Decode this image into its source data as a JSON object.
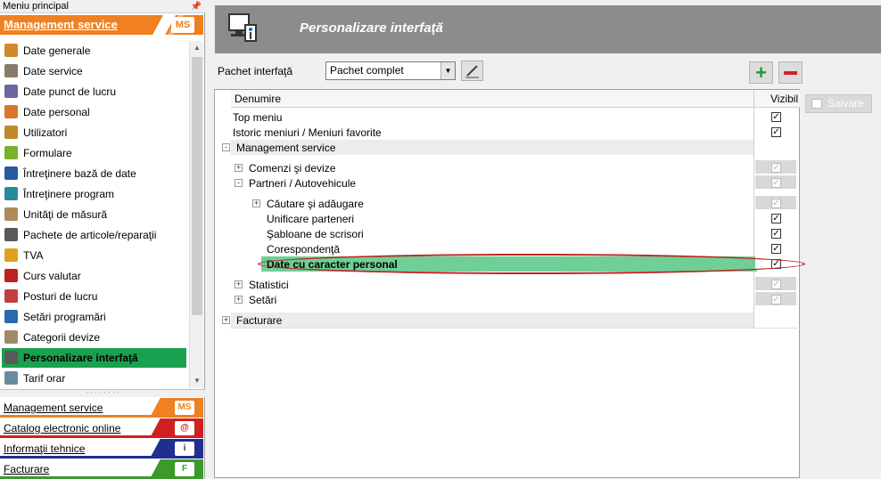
{
  "left": {
    "header": "Meniu principal",
    "section_title": "Management service",
    "items": [
      {
        "label": "Date generale",
        "icon": "document-icon",
        "color": "#d08a2a"
      },
      {
        "label": "Date service",
        "icon": "building-icon",
        "color": "#8a7a6a"
      },
      {
        "label": "Date punct de lucru",
        "icon": "workstation-icon",
        "color": "#6a6aa0"
      },
      {
        "label": "Date personal",
        "icon": "person-icon",
        "color": "#d9772a"
      },
      {
        "label": "Utilizatori",
        "icon": "users-icon",
        "color": "#c0892a"
      },
      {
        "label": "Formulare",
        "icon": "forms-icon",
        "color": "#7ab02a"
      },
      {
        "label": "Întreţinere bază de date",
        "icon": "database-save-icon",
        "color": "#2a5aa0"
      },
      {
        "label": "Întreţinere program",
        "icon": "program-icon",
        "color": "#2a8a9a"
      },
      {
        "label": "Unităţi de măsură",
        "icon": "ruler-icon",
        "color": "#b08a5a"
      },
      {
        "label": "Pachete de articole/reparaţii",
        "icon": "package-icon",
        "color": "#5a5a5a"
      },
      {
        "label": "TVA",
        "icon": "tax-icon",
        "color": "#e0a020"
      },
      {
        "label": "Curs valutar",
        "icon": "currency-icon",
        "color": "#c02020"
      },
      {
        "label": "Posturi de lucru",
        "icon": "lift-icon",
        "color": "#c04040"
      },
      {
        "label": "Setări programări",
        "icon": "wrench-icon",
        "color": "#2a6ab0"
      },
      {
        "label": "Categorii devize",
        "icon": "list-icon",
        "color": "#a08a6a"
      },
      {
        "label": "Personalizare interfaţă",
        "icon": "customize-icon",
        "color": "#5a5a5a"
      },
      {
        "label": "Tarif orar",
        "icon": "rate-icon",
        "color": "#6a8aa0"
      }
    ],
    "bottom_tabs": [
      {
        "label": "Management service",
        "color": "#f08020",
        "icon": "MS"
      },
      {
        "label": "Catalog electronic online",
        "color": "#d02020",
        "icon": "@"
      },
      {
        "label": "Informaţii tehnice",
        "color": "#1f2f8f",
        "icon": "i"
      },
      {
        "label": "Facturare",
        "color": "#3a9a2a",
        "icon": "F"
      }
    ]
  },
  "page": {
    "title": "Personalizare interfaţă",
    "package_label": "Pachet interfaţă",
    "package_value": "Pachet complet",
    "save_label": "Salvare"
  },
  "grid": {
    "col_name": "Denumire",
    "col_visible": "Vizibil",
    "rows": [
      {
        "label": "Top meniu",
        "checked": true,
        "disabled": false
      },
      {
        "label": "Istoric meniuri / Meniuri favorite",
        "checked": true,
        "disabled": false
      },
      {
        "label": "Management service",
        "group": true
      },
      {
        "label": "Comenzi şi devize",
        "checked": true,
        "disabled": true
      },
      {
        "label": "Partneri / Autovehicule",
        "checked": true,
        "disabled": true
      },
      {
        "label": "Căutare şi adăugare",
        "checked": true,
        "disabled": true
      },
      {
        "label": "Unificare parteneri",
        "checked": true,
        "disabled": false
      },
      {
        "label": "Şabloane de scrisori",
        "checked": true,
        "disabled": false
      },
      {
        "label": "Corespondenţă",
        "checked": true,
        "disabled": false
      },
      {
        "label": "Date cu caracter personal",
        "checked": true,
        "disabled": false,
        "selected": true
      },
      {
        "label": "Statistici",
        "checked": true,
        "disabled": true
      },
      {
        "label": "Setări",
        "checked": true,
        "disabled": true
      },
      {
        "label": "Facturare",
        "group": true
      }
    ]
  }
}
